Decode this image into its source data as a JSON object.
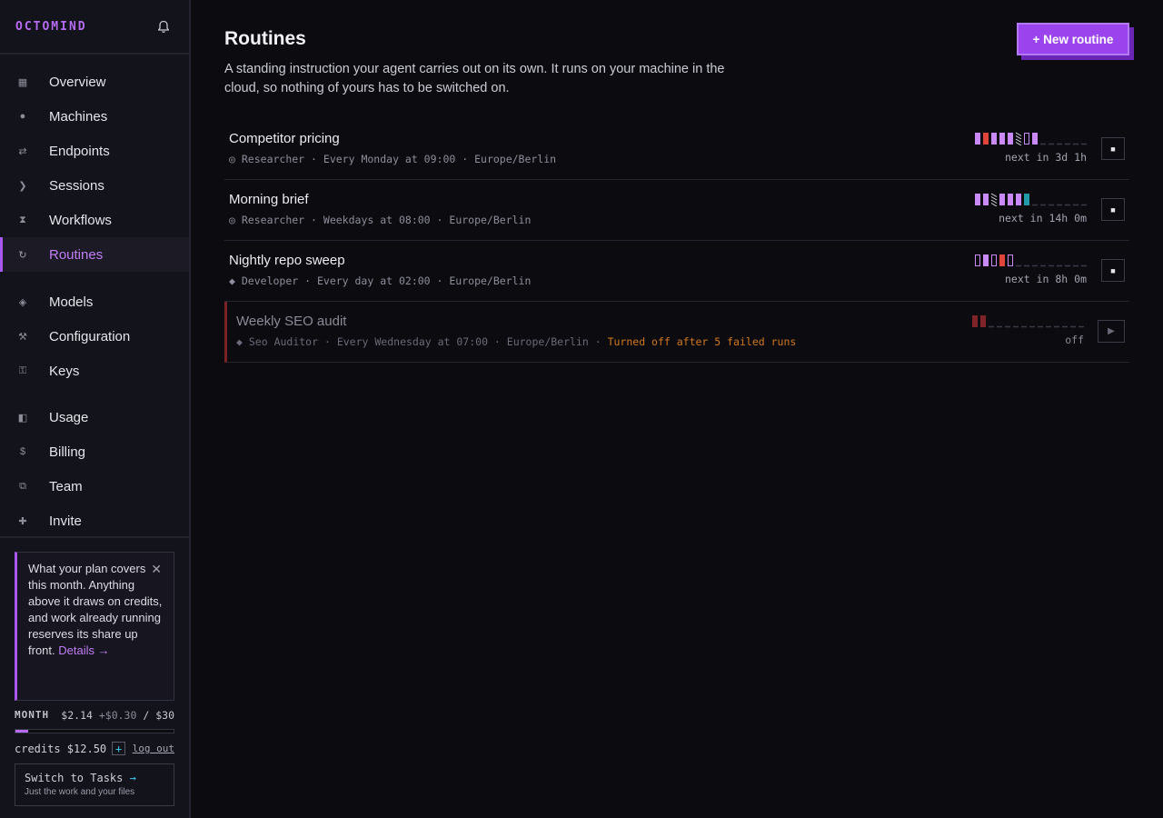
{
  "brand": {
    "logo": "OCTOMIND"
  },
  "nav": {
    "groups": [
      [
        {
          "label": "Overview",
          "icon": "grid-icon",
          "glyph": "▦"
        },
        {
          "label": "Machines",
          "icon": "circle-icon",
          "glyph": "●"
        },
        {
          "label": "Endpoints",
          "icon": "arrows-icon",
          "glyph": "⇄"
        },
        {
          "label": "Sessions",
          "icon": "chevron-right-icon",
          "glyph": "❯"
        },
        {
          "label": "Workflows",
          "icon": "hourglass-icon",
          "glyph": "⧗"
        },
        {
          "label": "Routines",
          "icon": "refresh-icon",
          "glyph": "↻",
          "active": true
        }
      ],
      [
        {
          "label": "Models",
          "icon": "diamond-icon",
          "glyph": "◈"
        },
        {
          "label": "Configuration",
          "icon": "tools-icon",
          "glyph": "⚒"
        },
        {
          "label": "Keys",
          "icon": "key-icon",
          "glyph": "⚿"
        }
      ],
      [
        {
          "label": "Usage",
          "icon": "half-square-icon",
          "glyph": "◧"
        },
        {
          "label": "Billing",
          "icon": "dollar-icon",
          "glyph": "$"
        },
        {
          "label": "Team",
          "icon": "team-icon",
          "glyph": "⧉"
        },
        {
          "label": "Invite",
          "icon": "plus-icon",
          "glyph": "✚"
        }
      ]
    ]
  },
  "plan": {
    "text": "What your plan covers this month. Anything above it draws on credits, and work already running reserves its share up front.",
    "details_label": "Details →",
    "close_glyph": "✕"
  },
  "month": {
    "label": "MONTH",
    "used": "$2.14",
    "reserved": "+$0.30",
    "separator": "/",
    "limit": "$30",
    "fill_percent": 8
  },
  "credits": {
    "text": "credits $12.50",
    "add_glyph": "+",
    "logout_label": "log out"
  },
  "switch": {
    "title": "Switch to Tasks",
    "arrow": "→",
    "subtitle": "Just the work and your files"
  },
  "page": {
    "title": "Routines",
    "description": "A standing instruction your agent carries out on its own. It runs on your machine in the cloud, so nothing of yours has to be switched on.",
    "new_button": "+ New routine"
  },
  "colors": {
    "accent": "#a858f0",
    "success": "#c98af7",
    "failure": "#e0443a",
    "teal": "#1f9aa6",
    "failure_dim": "#7e2428",
    "warning": "#e0832a"
  },
  "routines": [
    {
      "name": "Competitor pricing",
      "agent_icon": "◎",
      "agent": "Researcher",
      "schedule": "Every Monday at 09:00",
      "timezone": "Europe/Berlin",
      "next": "next in 3d 1h",
      "control": "stop-icon",
      "control_glyph": "■",
      "history": [
        "ok",
        "fail",
        "ok",
        "ok",
        "ok",
        "partial",
        "empty",
        "ok"
      ],
      "enabled": true
    },
    {
      "name": "Morning brief",
      "agent_icon": "◎",
      "agent": "Researcher",
      "schedule": "Weekdays at 08:00",
      "timezone": "Europe/Berlin",
      "next": "next in 14h 0m",
      "control": "stop-icon",
      "control_glyph": "■",
      "history": [
        "ok",
        "ok",
        "partial",
        "ok",
        "ok",
        "ok",
        "teal"
      ],
      "enabled": true
    },
    {
      "name": "Nightly repo sweep",
      "agent_icon": "◆",
      "agent": "Developer",
      "schedule": "Every day at 02:00",
      "timezone": "Europe/Berlin",
      "next": "next in 8h 0m",
      "control": "stop-icon",
      "control_glyph": "■",
      "history": [
        "empty",
        "ok",
        "empty",
        "fail",
        "empty"
      ],
      "enabled": true
    },
    {
      "name": "Weekly SEO audit",
      "agent_icon": "◆",
      "agent": "Seo Auditor",
      "schedule": "Every Wednesday at 07:00",
      "timezone": "Europe/Berlin",
      "warning": "Turned off after 5 failed runs",
      "next": "off",
      "control": "play-icon",
      "control_glyph": "▶",
      "history": [
        "faildim",
        "faildim"
      ],
      "enabled": false
    }
  ]
}
